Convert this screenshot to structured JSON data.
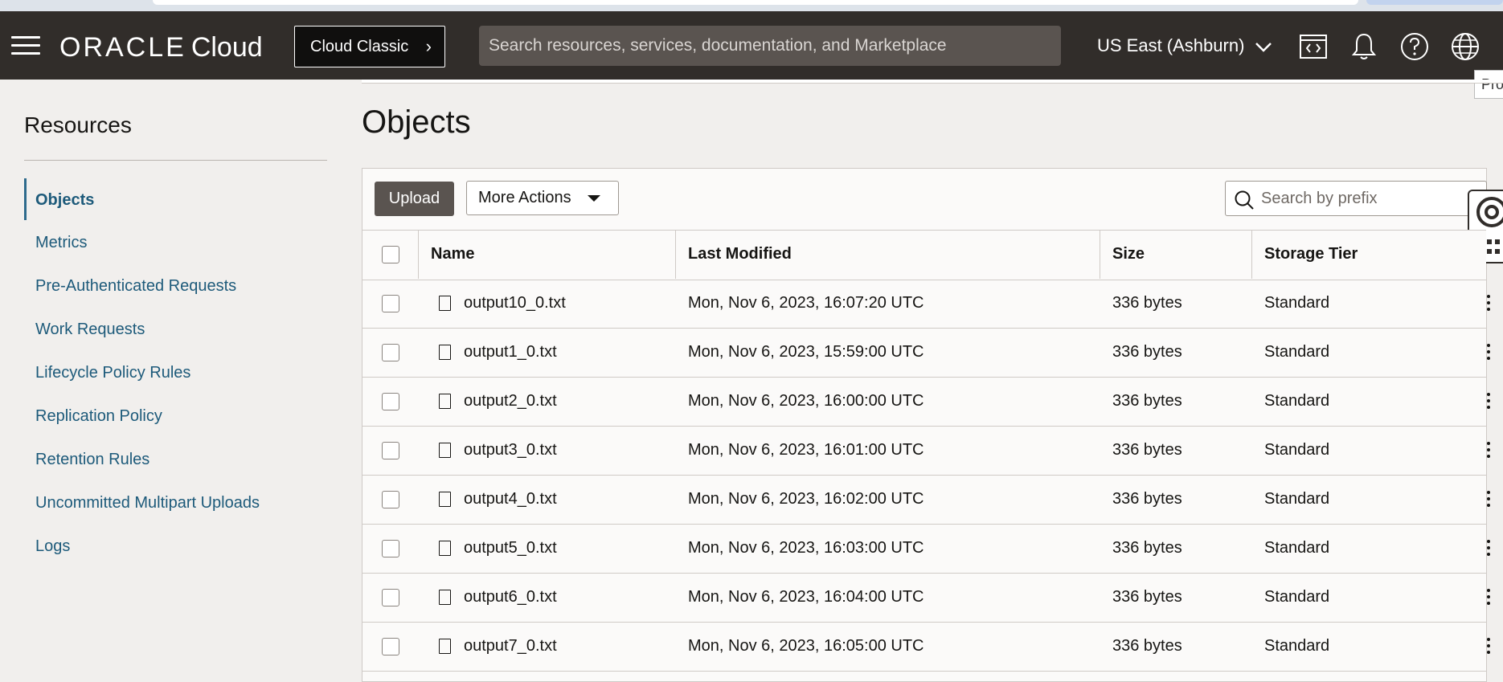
{
  "header": {
    "brand": "ORACLE",
    "brand_suffix": "Cloud",
    "classic_button": "Cloud Classic",
    "search_placeholder": "Search resources, services, documentation, and Marketplace",
    "region": "US East (Ashburn)",
    "tooltip": "Pro"
  },
  "sidebar": {
    "title": "Resources",
    "items": [
      {
        "label": "Objects",
        "active": true
      },
      {
        "label": "Metrics"
      },
      {
        "label": "Pre-Authenticated Requests"
      },
      {
        "label": "Work Requests"
      },
      {
        "label": "Lifecycle Policy Rules"
      },
      {
        "label": "Replication Policy"
      },
      {
        "label": "Retention Rules"
      },
      {
        "label": "Uncommitted Multipart Uploads"
      },
      {
        "label": "Logs"
      }
    ]
  },
  "main": {
    "title": "Objects",
    "upload_label": "Upload",
    "more_actions_label": "More Actions",
    "search_placeholder": "Search by prefix",
    "columns": [
      "Name",
      "Last Modified",
      "Size",
      "Storage Tier"
    ],
    "rows": [
      {
        "name": "output10_0.txt",
        "modified": "Mon, Nov 6, 2023, 16:07:20 UTC",
        "size": "336 bytes",
        "tier": "Standard"
      },
      {
        "name": "output1_0.txt",
        "modified": "Mon, Nov 6, 2023, 15:59:00 UTC",
        "size": "336 bytes",
        "tier": "Standard"
      },
      {
        "name": "output2_0.txt",
        "modified": "Mon, Nov 6, 2023, 16:00:00 UTC",
        "size": "336 bytes",
        "tier": "Standard"
      },
      {
        "name": "output3_0.txt",
        "modified": "Mon, Nov 6, 2023, 16:01:00 UTC",
        "size": "336 bytes",
        "tier": "Standard"
      },
      {
        "name": "output4_0.txt",
        "modified": "Mon, Nov 6, 2023, 16:02:00 UTC",
        "size": "336 bytes",
        "tier": "Standard"
      },
      {
        "name": "output5_0.txt",
        "modified": "Mon, Nov 6, 2023, 16:03:00 UTC",
        "size": "336 bytes",
        "tier": "Standard"
      },
      {
        "name": "output6_0.txt",
        "modified": "Mon, Nov 6, 2023, 16:04:00 UTC",
        "size": "336 bytes",
        "tier": "Standard"
      },
      {
        "name": "output7_0.txt",
        "modified": "Mon, Nov 6, 2023, 16:05:00 UTC",
        "size": "336 bytes",
        "tier": "Standard"
      }
    ]
  },
  "colors": {
    "topbar": "#312d2a",
    "link": "#1d5a7a",
    "upload_button": "#5a5450"
  }
}
